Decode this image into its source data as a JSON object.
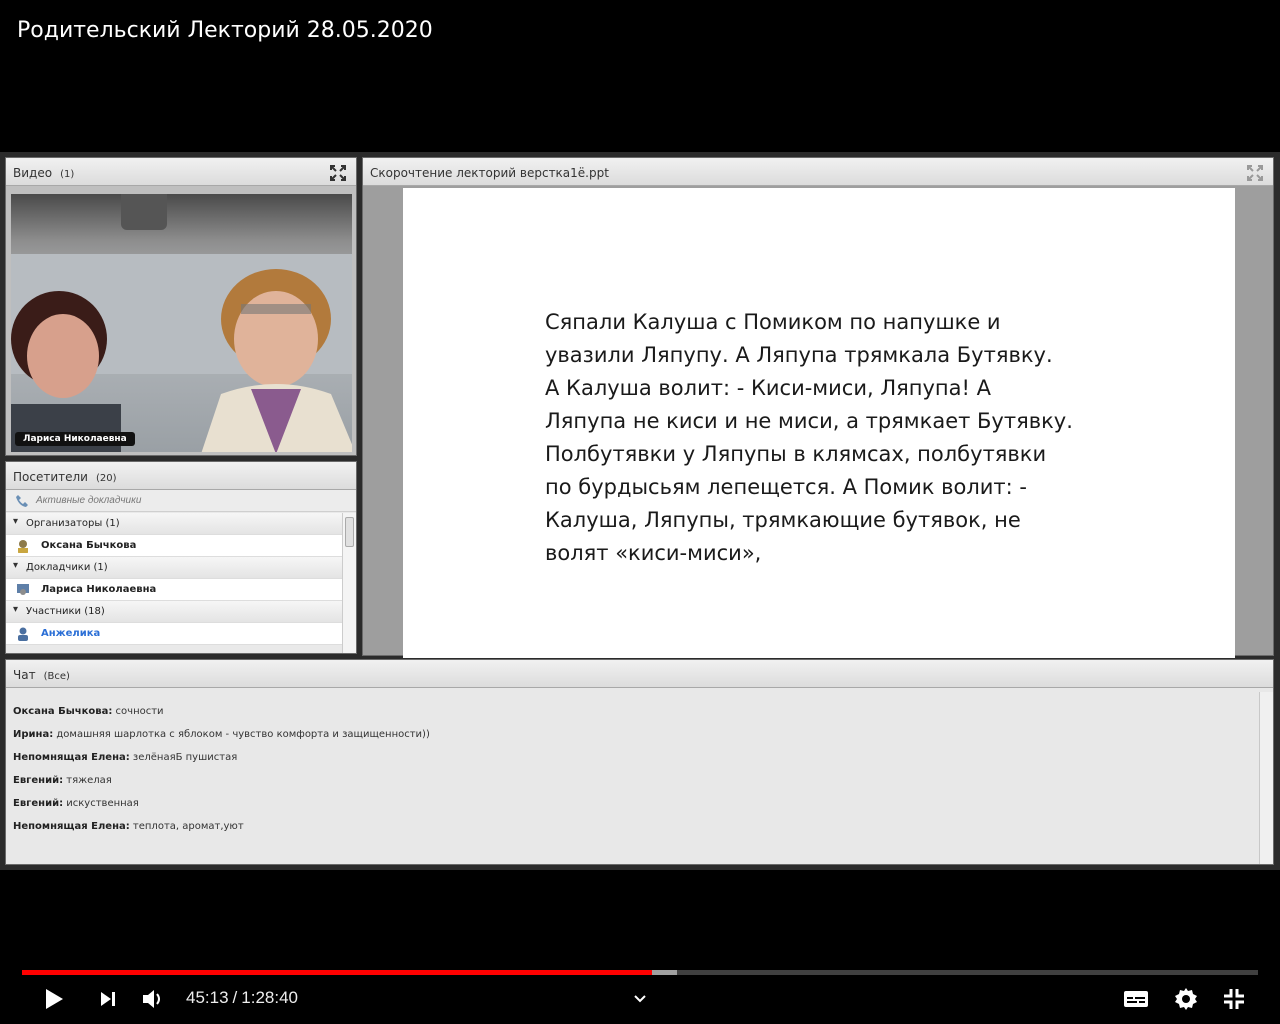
{
  "video_title": "Родительский Лекторий 28.05.2020",
  "video_pod": {
    "title": "Видео",
    "count": "(1)",
    "camera_label": "Лариса Николаевна"
  },
  "attendees_pod": {
    "title": "Посетители",
    "count": "(20)",
    "active_speakers": "Активные докладчики",
    "rows": [
      {
        "type": "group",
        "label": "Организаторы (1)"
      },
      {
        "type": "person",
        "label": "Оксана Бычкова",
        "icon": "host-icon"
      },
      {
        "type": "group",
        "label": "Докладчики (1)"
      },
      {
        "type": "person",
        "label": "Лариса Николаевна",
        "icon": "presenter-icon"
      },
      {
        "type": "group",
        "label": "Участники (18)"
      },
      {
        "type": "person",
        "label": "Анжелика",
        "icon": "participant-icon",
        "highlight": true
      }
    ]
  },
  "share_pod": {
    "title": "Скорочтение лекторий верстка1ё.ppt",
    "slide_lines": [
      "Сяпали Калуша с Помиком по напушке и",
      "увазили Ляпупу. А Ляпупа трямкала Бутявку.",
      "А Калуша волит:  - Киси-миси, Ляпупа!  А",
      "Ляпупа не киси и не миси, а трямкает Бутявку.",
      "Полбутявки у Ляпупы в клямсах, полбутявки",
      "по бурдысьям лепещется.  А Помик волит:  -",
      "Калуша, Ляпупы, трямкающие бутявок, не",
      "волят «киси-миси»,"
    ]
  },
  "chat_pod": {
    "title": "Чат",
    "scope": "(Все)",
    "messages": [
      {
        "author": "Оксана Бычкова:",
        "text": " сочности"
      },
      {
        "author": "Ирина:",
        "text": " домашняя шарлотка с яблоком - чувство комфорта и защищенности))"
      },
      {
        "author": "Непомнящая Елена:",
        "text": " зелёнаяБ пушистая"
      },
      {
        "author": "Евгений:",
        "text": " тяжелая"
      },
      {
        "author": "Евгений:",
        "text": " искуственная"
      },
      {
        "author": "Непомнящая Елена:",
        "text": " теплота, аромат,уют"
      }
    ]
  },
  "player": {
    "current_time": "45:13",
    "separator": "/",
    "duration": "1:28:40",
    "played_fraction": 0.51,
    "buffered_fraction": 0.53,
    "accent": "#ff0000"
  }
}
